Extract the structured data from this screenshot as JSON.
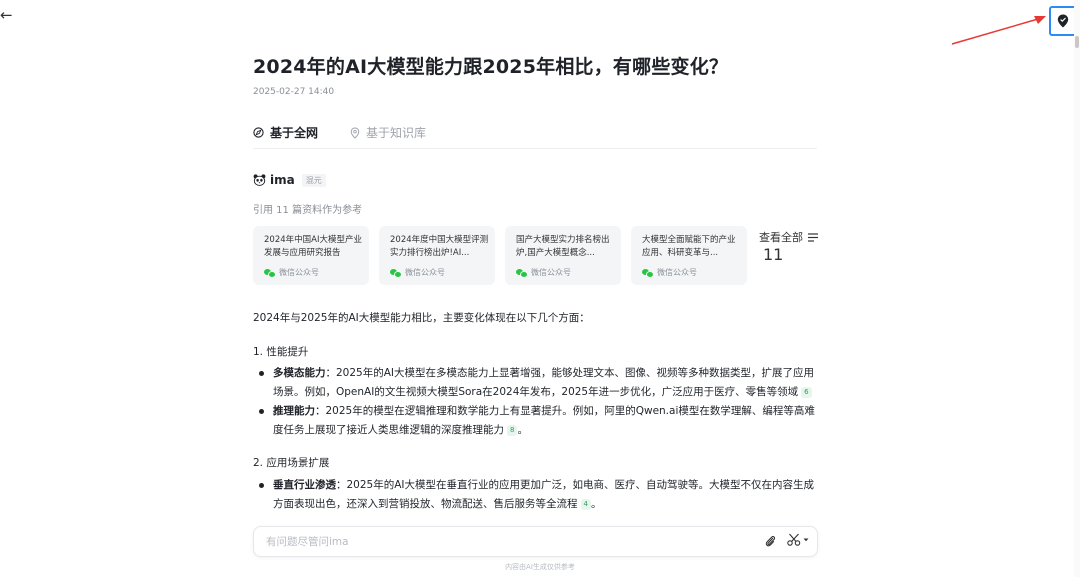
{
  "nav": {
    "back_glyph": "←",
    "pin_icon": "map-pin-icon"
  },
  "article": {
    "title": "2024年的AI大模型能力跟2025年相比，有哪些变化？",
    "date": "2025-02-27 14:40"
  },
  "tabs": [
    {
      "label": "基于全网",
      "icon": "compass-icon",
      "active": true
    },
    {
      "label": "基于知识库",
      "icon": "location-pin-icon",
      "active": false
    }
  ],
  "source": {
    "name": "ima",
    "badge": "混元",
    "icon": "panda-icon"
  },
  "references": {
    "summary": "引用 11 篇资料作为参考",
    "cards": [
      {
        "title": "2024年中国AI大模型产业发展与应用研究报告",
        "source": "微信公众号"
      },
      {
        "title": "2024年度中国大模型评测实力排行榜出炉!AI...",
        "source": "微信公众号"
      },
      {
        "title": "国产大模型实力排名榜出炉,国产大模型概念...",
        "source": "微信公众号"
      },
      {
        "title": "大模型全面赋能下的产业应用、科研变革与...",
        "source": "微信公众号"
      }
    ],
    "view_all_label": "查看全部",
    "count": "11"
  },
  "answer": {
    "intro": "2024年与2025年的AI大模型能力相比，主要变化体现在以下几个方面：",
    "sections": [
      {
        "heading": "1. 性能提升",
        "bullets": [
          {
            "term": "多模态能力",
            "text": "：2025年的AI大模型在多模态能力上显著增强，能够处理文本、图像、视频等多种数据类型，扩展了应用场景。例如，OpenAI的文生视频大模型Sora在2024年发布，2025年进一步优化，广泛应用于医疗、零售等领域",
            "cite": "6",
            "end": "。"
          },
          {
            "term": "推理能力",
            "text": "：2025年的模型在逻辑推理和数学能力上有显著提升。例如，阿里的Qwen.ai模型在数学理解、编程等高难度任务上展现了接近人类思维逻辑的深度推理能力",
            "cite": "8",
            "end": "。"
          }
        ]
      },
      {
        "heading": "2. 应用场景扩展",
        "bullets": [
          {
            "term": "垂直行业渗透",
            "text": "：2025年的AI大模型在垂直行业的应用更加广泛，如电商、医疗、自动驾驶等。大模型不仅在内容生成方面表现出色，还深入到营销投放、物流配送、售后服务等全流程",
            "cite": "4",
            "end": "。"
          },
          {
            "term": "",
            "text": "",
            "cite": "",
            "end": ""
          }
        ]
      }
    ]
  },
  "input": {
    "placeholder": "有问题尽管问ima",
    "value": ""
  },
  "disclaimer": "内容由AI生成仅供参考",
  "colors": {
    "accent": "#2b8cf5",
    "annotation_arrow": "#e53935",
    "citation_green": "#2e9e58",
    "wechat_green": "#28c445"
  }
}
